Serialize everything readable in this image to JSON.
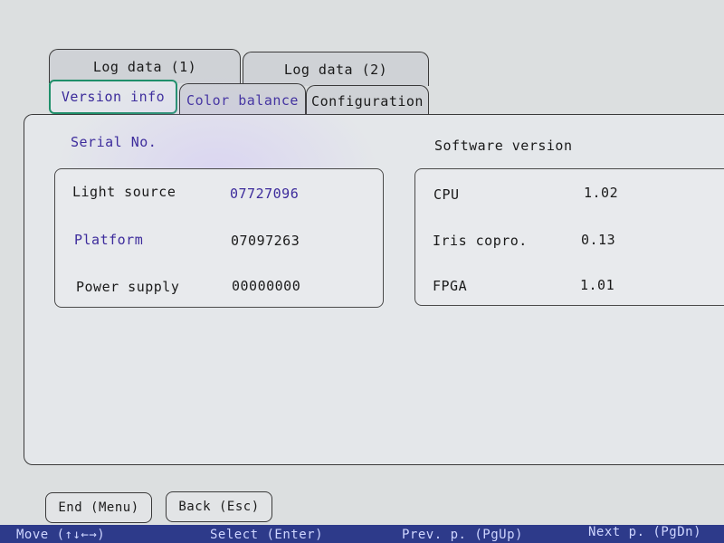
{
  "tabs": {
    "log1": "Log data (1)",
    "log2": "Log data (2)",
    "version": "Version info",
    "color": "Color balance",
    "config": "Configuration"
  },
  "serial": {
    "heading": "Serial No.",
    "rows": [
      {
        "label": "Light source",
        "value": "07727096"
      },
      {
        "label": "Platform",
        "value": "07097263"
      },
      {
        "label": "Power supply",
        "value": "00000000"
      }
    ]
  },
  "software": {
    "heading": "Software version",
    "rows": [
      {
        "label": "CPU",
        "value": "1.02"
      },
      {
        "label": "Iris copro.",
        "value": "0.13"
      },
      {
        "label": "FPGA",
        "value": "1.01"
      }
    ]
  },
  "buttons": {
    "end": "End (Menu)",
    "back": "Back (Esc)"
  },
  "statusbar": {
    "move": "Move (↑↓←→)",
    "select": "Select (Enter)",
    "prev": "Prev. p. (PgUp)",
    "next": "Next p. (PgDn)"
  },
  "colors": {
    "active_tab_border": "#1f8f6a",
    "label_purple": "#3d2c9c",
    "statusbar_bg": "#2d3a8a"
  }
}
